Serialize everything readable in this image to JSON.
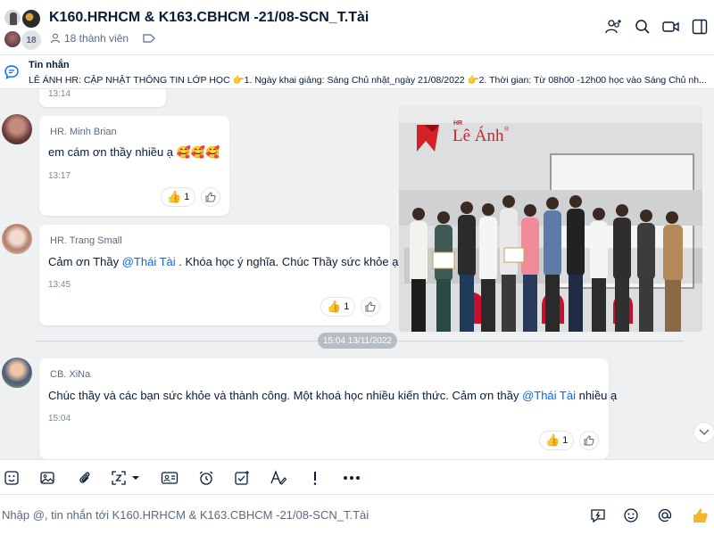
{
  "header": {
    "title": "K160.HRHCM & K163.CBHCM -21/08-SCN_T.Tài",
    "avatar_count": "18",
    "members_label": "18 thành viên",
    "icons": [
      "add-member-icon",
      "search-icon",
      "video-call-icon",
      "sidebar-toggle-icon"
    ]
  },
  "pinned": {
    "label": "Tin nhắn",
    "text": "LÊ ÁNH HR: CẬP NHẬT THÔNG TIN LỚP HỌC 👉1. Ngày khai giảng: Sáng Chủ nhật_ngày 21/08/2022 👉2. Thời gian: Từ 08h00 -12h00 học vào Sáng Chủ nh..."
  },
  "messages": [
    {
      "time": "13:14"
    },
    {
      "sender": "HR. Minh  Brian",
      "text": "em cám ơn thầy nhiều ạ 🥰🥰🥰",
      "time": "13:17",
      "reactions": {
        "emoji": "👍",
        "count": "1"
      }
    },
    {
      "sender": "HR. Trang Small",
      "text_before": "Cảm ơn Thầy ",
      "mention": "@Thái Tài",
      "text_after": " . Khóa học ý nghĩa. Chúc Thầy sức khỏe ạ.",
      "time": "13:45",
      "reactions": {
        "emoji": "👍",
        "count": "1"
      }
    },
    {
      "sender": "CB. XiNa",
      "text_before": "Chúc thầy và các bạn sức khỏe và thành công. Một khoá học nhiều kiến thức. Cảm ơn thầy ",
      "mention": "@Thái Tài",
      "text_after": "  nhiều ạ",
      "time": "15:04",
      "reactions": {
        "emoji": "👍",
        "count": "1"
      }
    }
  ],
  "photo": {
    "logo_prefix": "HR",
    "logo_text": "Lê Ánh",
    "logo_registered": "®"
  },
  "date_chip": "15:04 13/11/2022",
  "toolbar": {
    "icons": [
      "sticker-icon",
      "image-icon",
      "attachment-icon",
      "screenshot-icon",
      "contact-card-icon",
      "reminder-icon",
      "task-icon",
      "format-text-icon",
      "urgent-icon",
      "more-icon"
    ]
  },
  "composer": {
    "placeholder": "Nhập @, tin nhắn tới K160.HRHCM & K163.CBHCM -21/08-SCN_T.Tài",
    "icons": [
      "quick-message-icon",
      "emoji-icon",
      "mention-icon",
      "thumbs-up-icon"
    ]
  },
  "colors": {
    "accent": "#0068ff",
    "chat_bg": "#eef0f1",
    "logo_red": "#d42027"
  }
}
